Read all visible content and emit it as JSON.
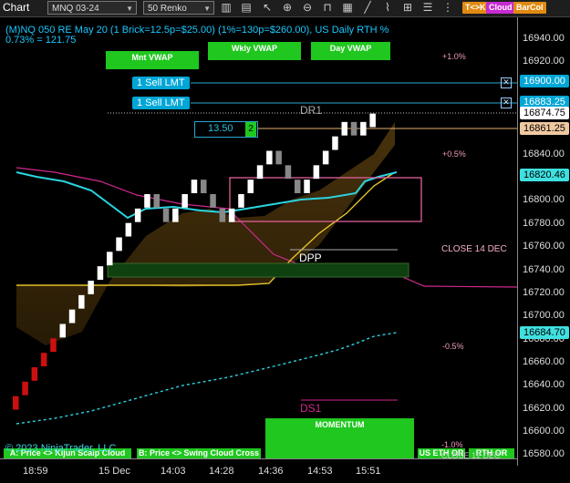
{
  "toolbar": {
    "title": "Chart",
    "instrument": "MNQ 03-24",
    "bar_type": "50 Renko",
    "buttons": [
      "T<>K",
      "Cloud",
      "BarCol"
    ]
  },
  "header": {
    "line1": "(M)NQ 050 RE May 20 (1 Brick=12.5p=$25.00) (1%=130p=$260.00), US Daily RTH %",
    "line2": "0.73% = 121.75"
  },
  "vwap_buttons": {
    "mnt": "Mnt VWAP",
    "wkly": "Wkly VWAP",
    "day": "Day VWAP"
  },
  "orders": [
    {
      "label": "1 Sell LMT",
      "price_tag": "16900.00"
    },
    {
      "label": "1 Sell LMT",
      "price_tag": "16883.25"
    }
  ],
  "position": {
    "price": "13.50",
    "qty": "2"
  },
  "levels": {
    "dr1": "DR1",
    "dpp": "DPP",
    "ds1": "DS1",
    "close_14dec": "CLOSE 14 DEC",
    "close_12dec": "CLOSE 12 DEC",
    "pct_plus1": "+1.0%",
    "pct_plus05": "+0.5%",
    "pct_minus05": "-0.5%",
    "pct_minus1": "-1.0%"
  },
  "price_axis": {
    "ticks": [
      "16940.00",
      "16920.00",
      "16900.00",
      "16880.00",
      "16860.00",
      "16840.00",
      "16820.00",
      "16800.00",
      "16780.00",
      "16760.00",
      "16740.00",
      "16720.00",
      "16700.00",
      "16680.00",
      "16660.00",
      "16640.00",
      "16620.00",
      "16600.00",
      "16580.00"
    ],
    "tags": {
      "order1": "16900.00",
      "order2": "16883.25",
      "last": "16874.75",
      "entry": "16861.25",
      "cloud": "16820.46",
      "lower": "16684.70"
    },
    "colors": {
      "order": "#00a6d6",
      "entry": "#f0c8a0",
      "cloud": "#40e0e0"
    }
  },
  "time_axis": {
    "labels": [
      "18:59",
      "15 Dec",
      "14:03",
      "14:28",
      "14:36",
      "14:53",
      "15:51"
    ]
  },
  "bottom_buttons": {
    "kijun": "A: Price <> Kijun Scalp Cloud Cross",
    "swing": "B: Price <> Swing Cloud Cross",
    "momentum": "MOMENTUM",
    "us_eth": "US ETH OR",
    "rth": "RTH OR"
  },
  "copyright": "© 2023 NinjaTrader, LLC",
  "chart_data": {
    "type": "renko",
    "bricks": [
      16630,
      16642.5,
      16655,
      16667.5,
      16680,
      16692.5,
      16705,
      16717.5,
      16730,
      16742.5,
      16755,
      16767.5,
      16780,
      16792.5,
      16805,
      16792.5,
      16780,
      16792.5,
      16805,
      16817.5,
      16805,
      16792.5,
      16780,
      16792.5,
      16805,
      16817.5,
      16830,
      16842.5,
      16830,
      16817.5,
      16805,
      16817.5,
      16830,
      16842.5,
      16855,
      16867.5,
      16855,
      16867.5,
      16874.75
    ],
    "colors": {
      "up": "#ffffff",
      "down": "#888888",
      "early_down": "#cc1010"
    }
  }
}
